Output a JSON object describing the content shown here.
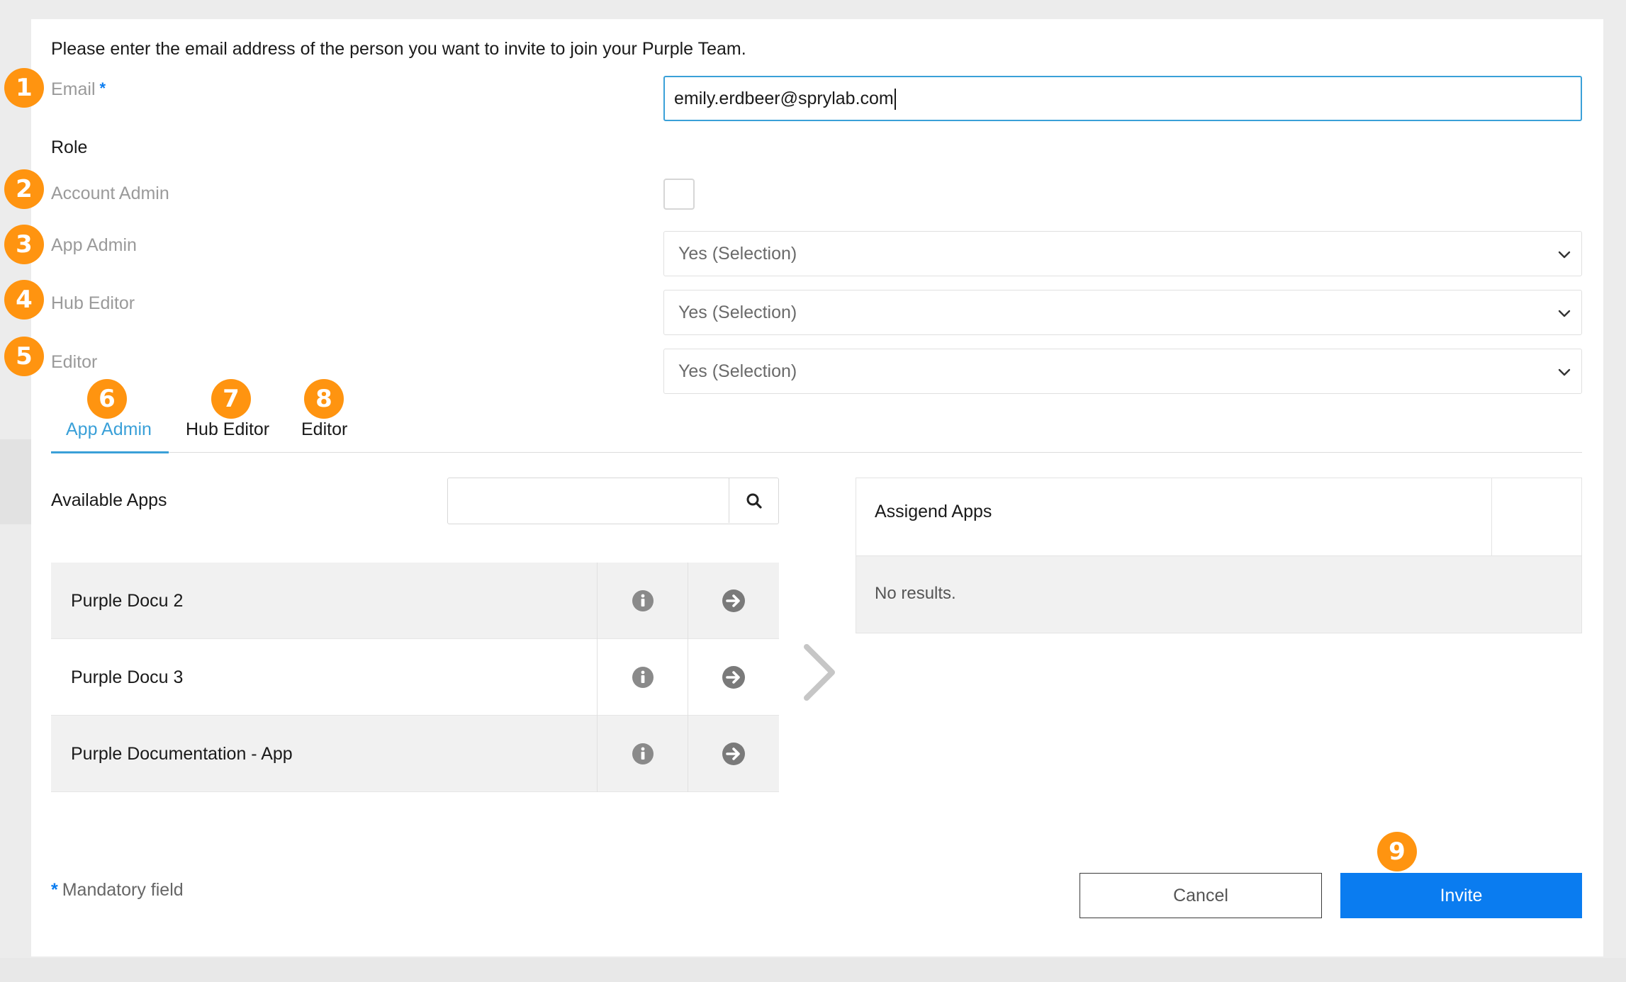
{
  "colors": {
    "accent": "#3aa0d8",
    "primary_button": "#0a7cf0",
    "badge": "#ff9410",
    "required_star": "#0a7cf0"
  },
  "form": {
    "intro": "Please enter the email address of the person you want to invite to join your Purple Team.",
    "email": {
      "label": "Email",
      "required_mark": "*",
      "value": "emily.erdbeer@sprylab.com"
    },
    "role_heading": "Role",
    "account_admin": {
      "label": "Account Admin",
      "checked": false
    },
    "app_admin": {
      "label": "App Admin",
      "selected": "Yes (Selection)"
    },
    "hub_editor": {
      "label": "Hub Editor",
      "selected": "Yes (Selection)"
    },
    "editor": {
      "label": "Editor",
      "selected": "Yes (Selection)"
    }
  },
  "tabs": [
    {
      "label": "App Admin",
      "active": true
    },
    {
      "label": "Hub Editor",
      "active": false
    },
    {
      "label": "Editor",
      "active": false
    }
  ],
  "available_apps": {
    "heading": "Available Apps",
    "search_value": "",
    "search_icon": "magnifier-icon",
    "rows": [
      {
        "name": "Purple Docu 2",
        "info_icon": "info-icon",
        "action_icon": "arrow-right-circle-icon"
      },
      {
        "name": "Purple Docu 3",
        "info_icon": "info-icon",
        "action_icon": "arrow-right-circle-icon"
      },
      {
        "name": "Purple Documentation - App",
        "info_icon": "info-icon",
        "action_icon": "arrow-right-circle-icon"
      }
    ]
  },
  "assigned_apps": {
    "heading": "Assigend Apps",
    "empty_text": "No results."
  },
  "footer": {
    "mandatory_star": "*",
    "mandatory_text": "Mandatory field",
    "cancel_label": "Cancel",
    "invite_label": "Invite"
  },
  "callouts": [
    "1",
    "2",
    "3",
    "4",
    "5",
    "6",
    "7",
    "8",
    "9"
  ]
}
